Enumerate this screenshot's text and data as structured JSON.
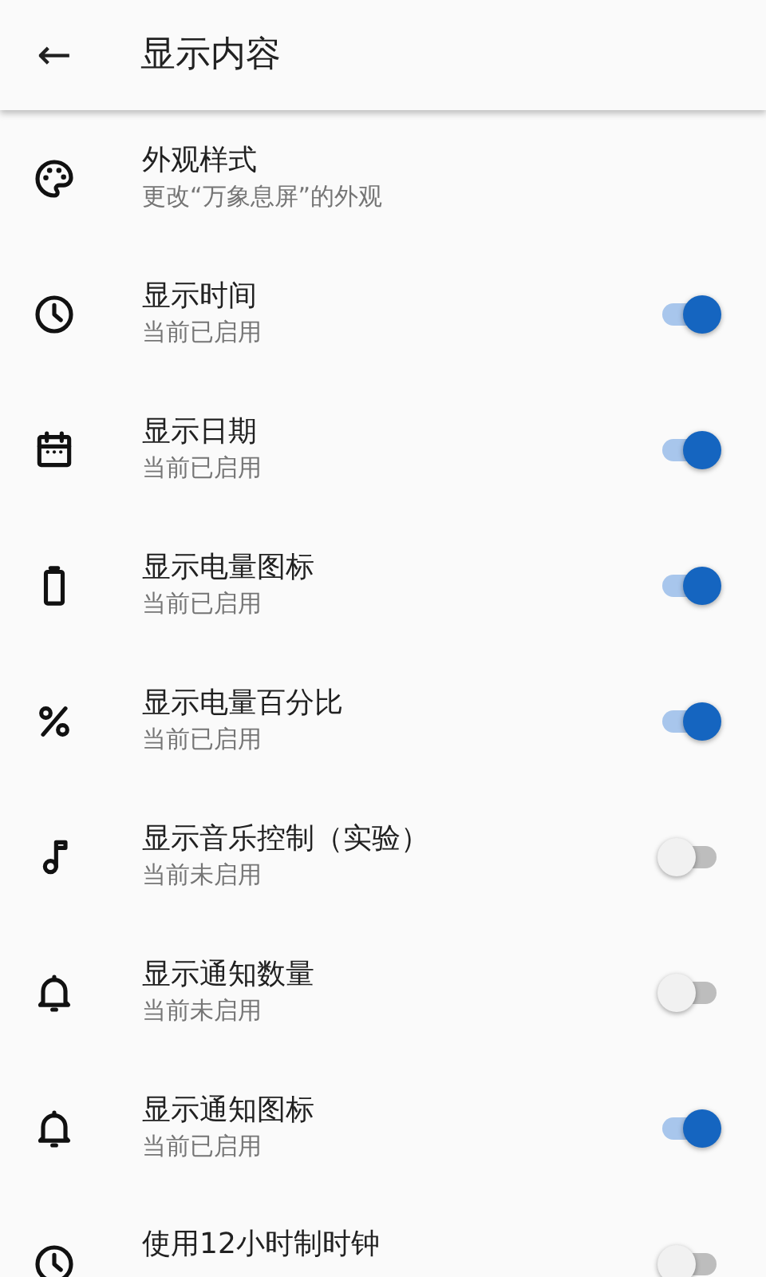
{
  "app_bar": {
    "back": "←",
    "title": "显示内容"
  },
  "settings": [
    {
      "kind": "link",
      "title": "外观样式",
      "summary": "更改“万象息屏”的外观"
    },
    {
      "kind": "toggle",
      "title": "显示时间",
      "summary": "当前已启用",
      "on": true
    },
    {
      "kind": "toggle",
      "title": "显示日期",
      "summary": "当前已启用",
      "on": true
    },
    {
      "kind": "toggle",
      "title": "显示电量图标",
      "summary": "当前已启用",
      "on": true
    },
    {
      "kind": "toggle",
      "title": "显示电量百分比",
      "summary": "当前已启用",
      "on": true
    },
    {
      "kind": "toggle",
      "title": "显示音乐控制（实验）",
      "summary": "当前未启用",
      "on": false
    },
    {
      "kind": "toggle",
      "title": "显示通知数量",
      "summary": "当前未启用",
      "on": false
    },
    {
      "kind": "toggle",
      "title": "显示通知图标",
      "summary": "当前已启用",
      "on": true
    },
    {
      "kind": "toggle",
      "title": "使用12小时制时钟",
      "on": false
    }
  ]
}
